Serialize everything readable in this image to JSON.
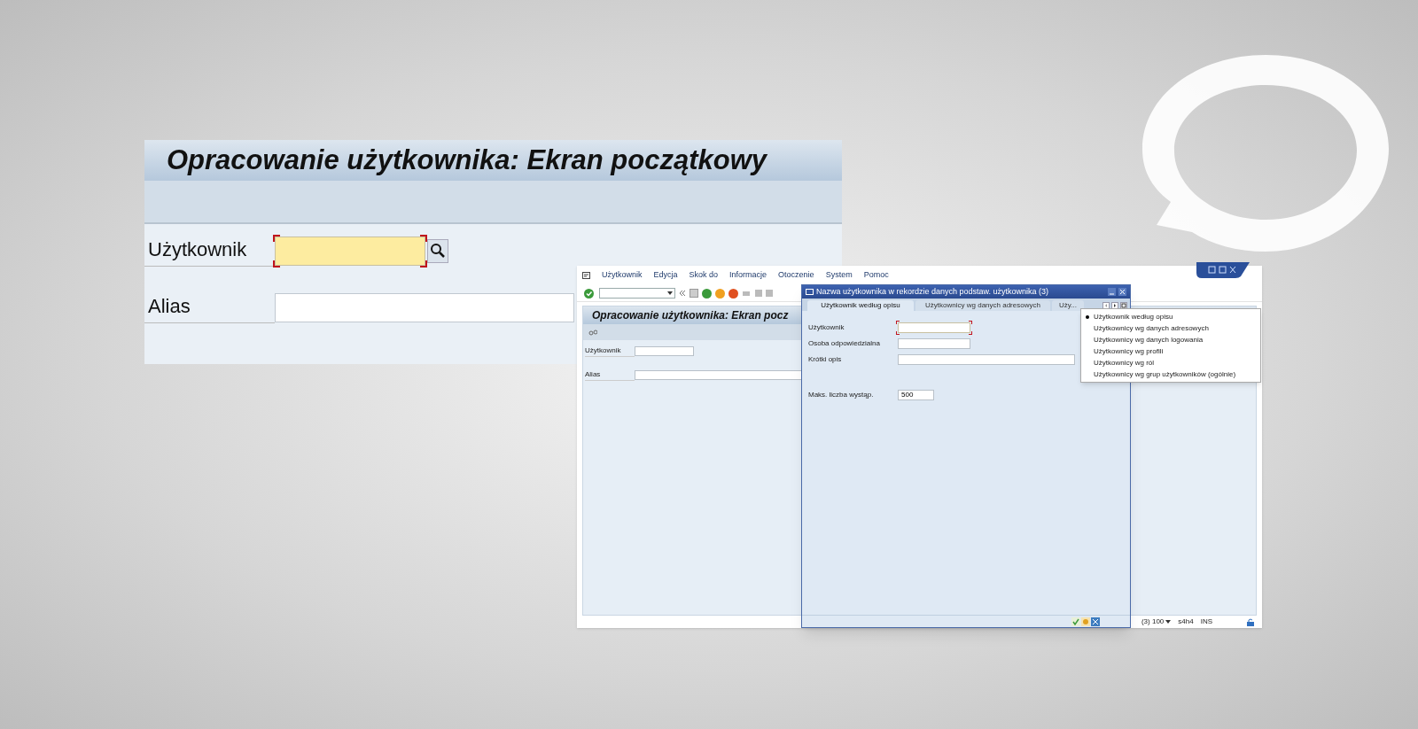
{
  "zoomed_screen": {
    "title": "Opracowanie użytkownika: Ekran początkowy",
    "fields": [
      {
        "label": "Użytkownik",
        "focused": true
      },
      {
        "label": "Alias",
        "focused": false
      }
    ]
  },
  "sap_window": {
    "menu": [
      "Użytkownik",
      "Edycja",
      "Skok do",
      "Informacje",
      "Otoczenie",
      "System",
      "Pomoc"
    ],
    "title": "Opracowanie użytkownika: Ekran pocz",
    "fields": [
      {
        "label": "Użytkownik"
      },
      {
        "label": "Alias"
      }
    ],
    "status": {
      "session": "(3) 100",
      "system": "s4h4",
      "mode": "INS"
    }
  },
  "dialog": {
    "title": "Nazwa użytkownika w rekordzie danych podstaw. użytkownika (3)",
    "tabs": [
      {
        "label": "Użytkownik według opisu",
        "selected": true
      },
      {
        "label": "Użytkownicy wg danych adresowych",
        "selected": false
      },
      {
        "label": "Uży...",
        "selected": false
      }
    ],
    "fields": [
      {
        "label": "Użytkownik",
        "focused": true
      },
      {
        "label": "Osoba odpowiedzialna",
        "focused": false
      },
      {
        "label": "Krótki opis",
        "focused": false
      },
      {
        "label": "Maks. liczba wystąp.",
        "value": "500",
        "focused": false
      }
    ],
    "tab_list": [
      {
        "label": "Użytkownik według opisu",
        "selected": true
      },
      {
        "label": "Użytkownicy wg danych adresowych",
        "selected": false
      },
      {
        "label": "Użytkownicy wg danych logowania",
        "selected": false
      },
      {
        "label": "Użytkownicy wg profili",
        "selected": false
      },
      {
        "label": "Użytkownicy wg ról",
        "selected": false
      },
      {
        "label": "Użytkownicy wg grup użytkowników (ogólnie)",
        "selected": false
      }
    ]
  }
}
